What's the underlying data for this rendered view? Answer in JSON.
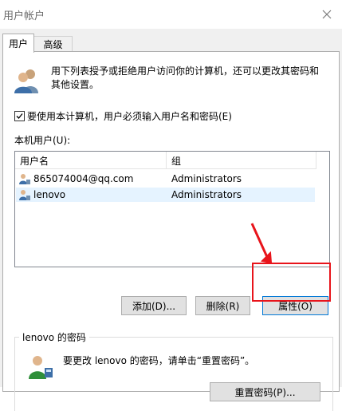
{
  "window": {
    "title": "用户帐户"
  },
  "tabs": [
    {
      "label": "用户"
    },
    {
      "label": "高级"
    }
  ],
  "description": "用下列表授予或拒绝用户访问你的计算机，还可以更改其密码和其他设置。",
  "require_login": {
    "label": "要使用本计算机，用户必须输入用户名和密码(E)",
    "checked": true
  },
  "local_users": {
    "label": "本机用户(U):",
    "columns": [
      "用户名",
      "组"
    ],
    "rows": [
      {
        "name": "865074004@qq.com",
        "group": "Administrators",
        "selected": false
      },
      {
        "name": "lenovo",
        "group": "Administrators",
        "selected": true
      }
    ]
  },
  "buttons": {
    "add": "添加(D)...",
    "remove": "删除(R)",
    "properties": "属性(O)"
  },
  "password_group": {
    "title": "lenovo 的密码",
    "text": "要更改 lenovo 的密码，请单击“重置密码”。",
    "reset_button": "重置密码(P)..."
  },
  "colors": {
    "annotation": "#e8141b",
    "selection": "#e5f3ff",
    "focus": "#0078d7"
  }
}
